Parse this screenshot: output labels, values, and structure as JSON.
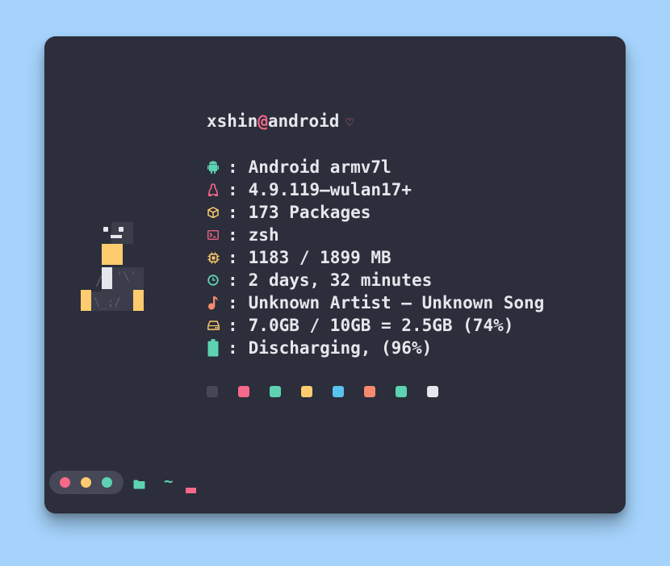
{
  "header": {
    "user": "xshin",
    "at": "@",
    "host": "android",
    "heart": "♡"
  },
  "info_rows": [
    {
      "icon": "android-icon",
      "color": "#5dd3b2",
      "sep": ":",
      "value": "Android armv7l"
    },
    {
      "icon": "linux-icon",
      "color": "#f7688a",
      "sep": ":",
      "value": "4.9.119—wulan17+"
    },
    {
      "icon": "package-icon",
      "color": "#fecc6e",
      "sep": ":",
      "value": "173 Packages"
    },
    {
      "icon": "terminal-icon",
      "color": "#f7688a",
      "sep": ":",
      "value": "zsh"
    },
    {
      "icon": "cpu-icon",
      "color": "#fecc6e",
      "sep": ":",
      "value": "1183 / 1899 MB"
    },
    {
      "icon": "clock-icon",
      "color": "#5dd3b2",
      "sep": ":",
      "value": "2 days, 32 minutes"
    },
    {
      "icon": "music-icon",
      "color": "#f78a6e",
      "sep": ":",
      "value": "Unknown Artist — Unknown Song"
    },
    {
      "icon": "hdd-icon",
      "color": "#fecc6e",
      "sep": ":",
      "value": "7.0GB / 10GB = 2.5GB (74%)"
    },
    {
      "icon": "battery-icon",
      "color": "#5dd3b2",
      "sep": ":",
      "value": "Discharging, (96%)"
    }
  ],
  "palette": [
    "#464857",
    "#f7688a",
    "#5dd3b2",
    "#fecc6e",
    "#59c3ef",
    "#f78a6e",
    "#5dd3b2",
    "#e6e7ec"
  ],
  "prompt": {
    "window_buttons": [
      "#f7688a",
      "#fecc6e",
      "#5dd3b2"
    ],
    "folder_icon": "folder-icon",
    "path": "~"
  },
  "colors": {
    "background": "#a5d3fb",
    "window": "#2c2e3b",
    "text": "#e6e7ec",
    "accent_pink": "#f7688a",
    "accent_green": "#5dd3b2",
    "accent_yellow": "#fecc6e"
  }
}
